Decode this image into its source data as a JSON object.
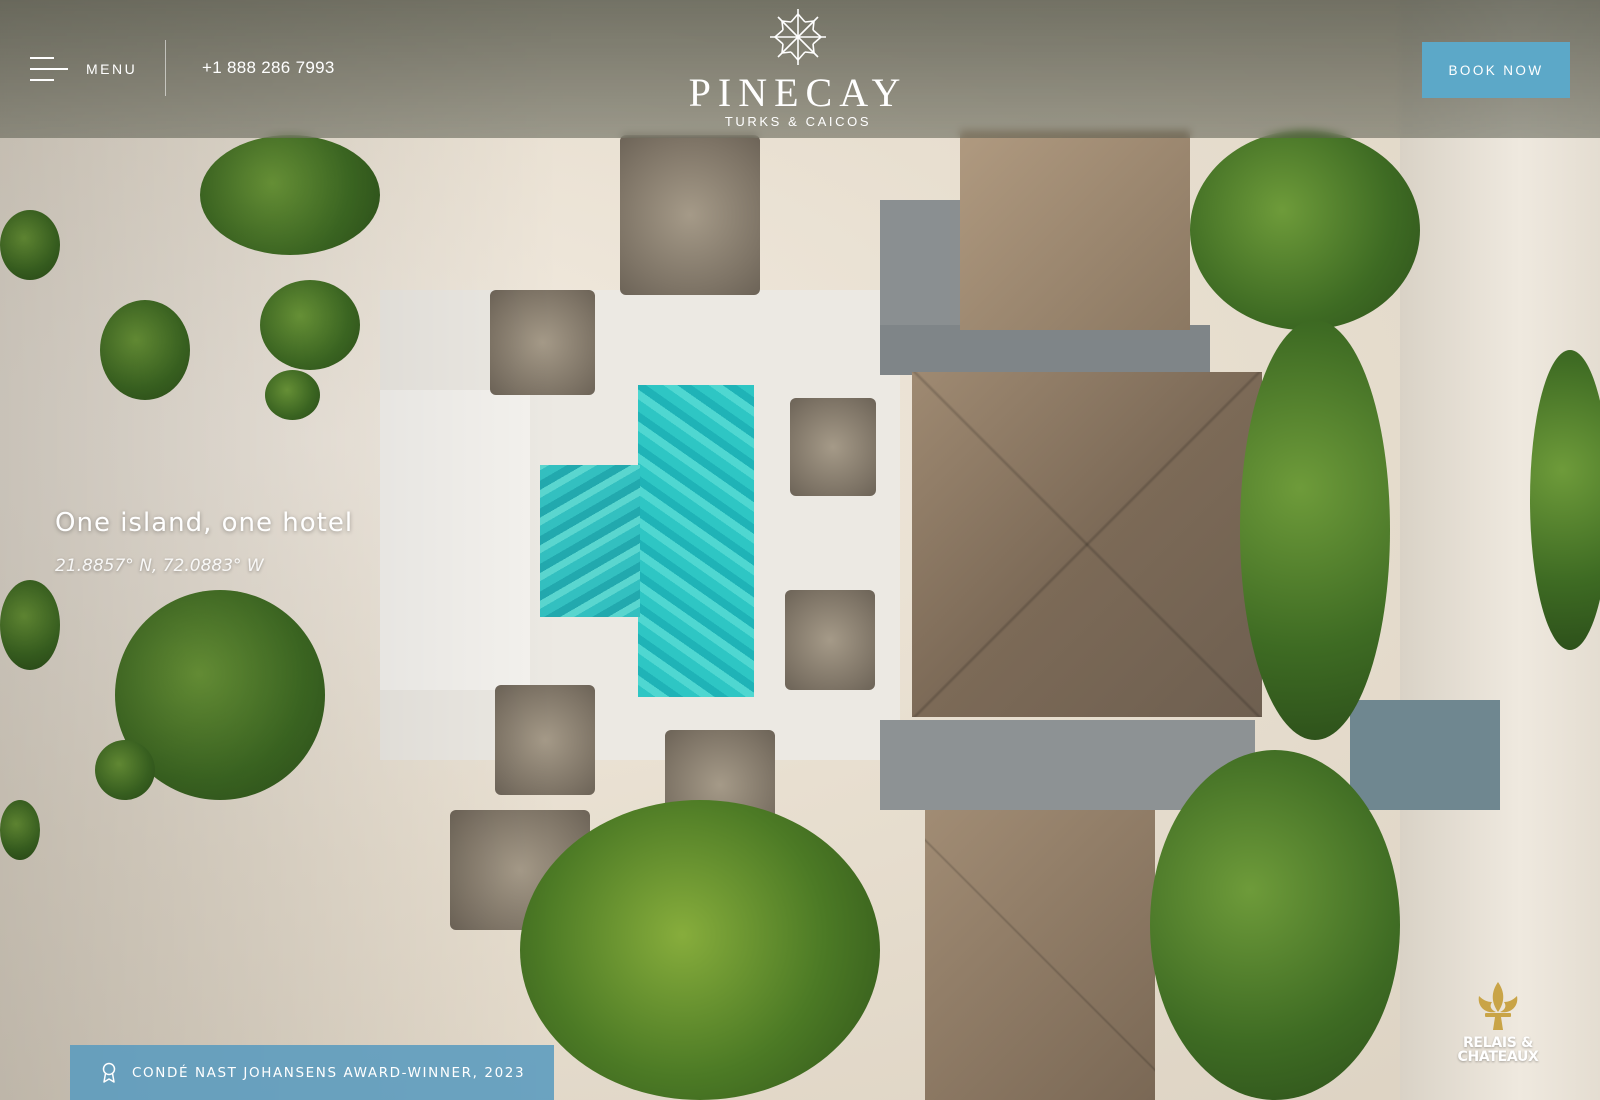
{
  "header": {
    "menu_label": "MENU",
    "phone": "+1 888 286 7993",
    "logo_name": "PINECAY",
    "logo_subtitle": "TURKS & CAICOS",
    "book_label": "BOOK NOW"
  },
  "hero": {
    "title": "One island, one hotel",
    "coordinates": "21.8857° N, 72.0883° W"
  },
  "award": {
    "text": "CONDÉ NAST JOHANSENS AWARD-WINNER, 2023",
    "icon": "award-ribbon-icon"
  },
  "badge": {
    "text_line1": "RELAIS &",
    "text_line2": "CHATEAUX",
    "icon": "fleur-de-lis-icon"
  },
  "colors": {
    "accent": "#5ca8c8",
    "award_bg": "#5a9bbe",
    "badge_gold": "#c9a447"
  }
}
